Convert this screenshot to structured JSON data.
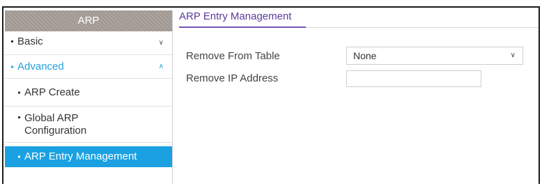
{
  "sidebar": {
    "header": "ARP",
    "basic": {
      "label": "Basic",
      "icon": "chevron-down-icon"
    },
    "advanced": {
      "label": "Advanced",
      "icon": "chevron-up-icon",
      "color": "#25a0dd"
    },
    "items": [
      {
        "label": "ARP Create"
      },
      {
        "label_line1": "Global ARP",
        "label_line2": "Configuration"
      },
      {
        "label": "ARP Entry Management",
        "active": true,
        "color": "#1ba1e2"
      }
    ]
  },
  "main": {
    "tab_title": "ARP Entry Management",
    "remove_from_table": {
      "label": "Remove From Table",
      "value": "None"
    },
    "remove_ip": {
      "label": "Remove IP Address",
      "value": ""
    }
  }
}
